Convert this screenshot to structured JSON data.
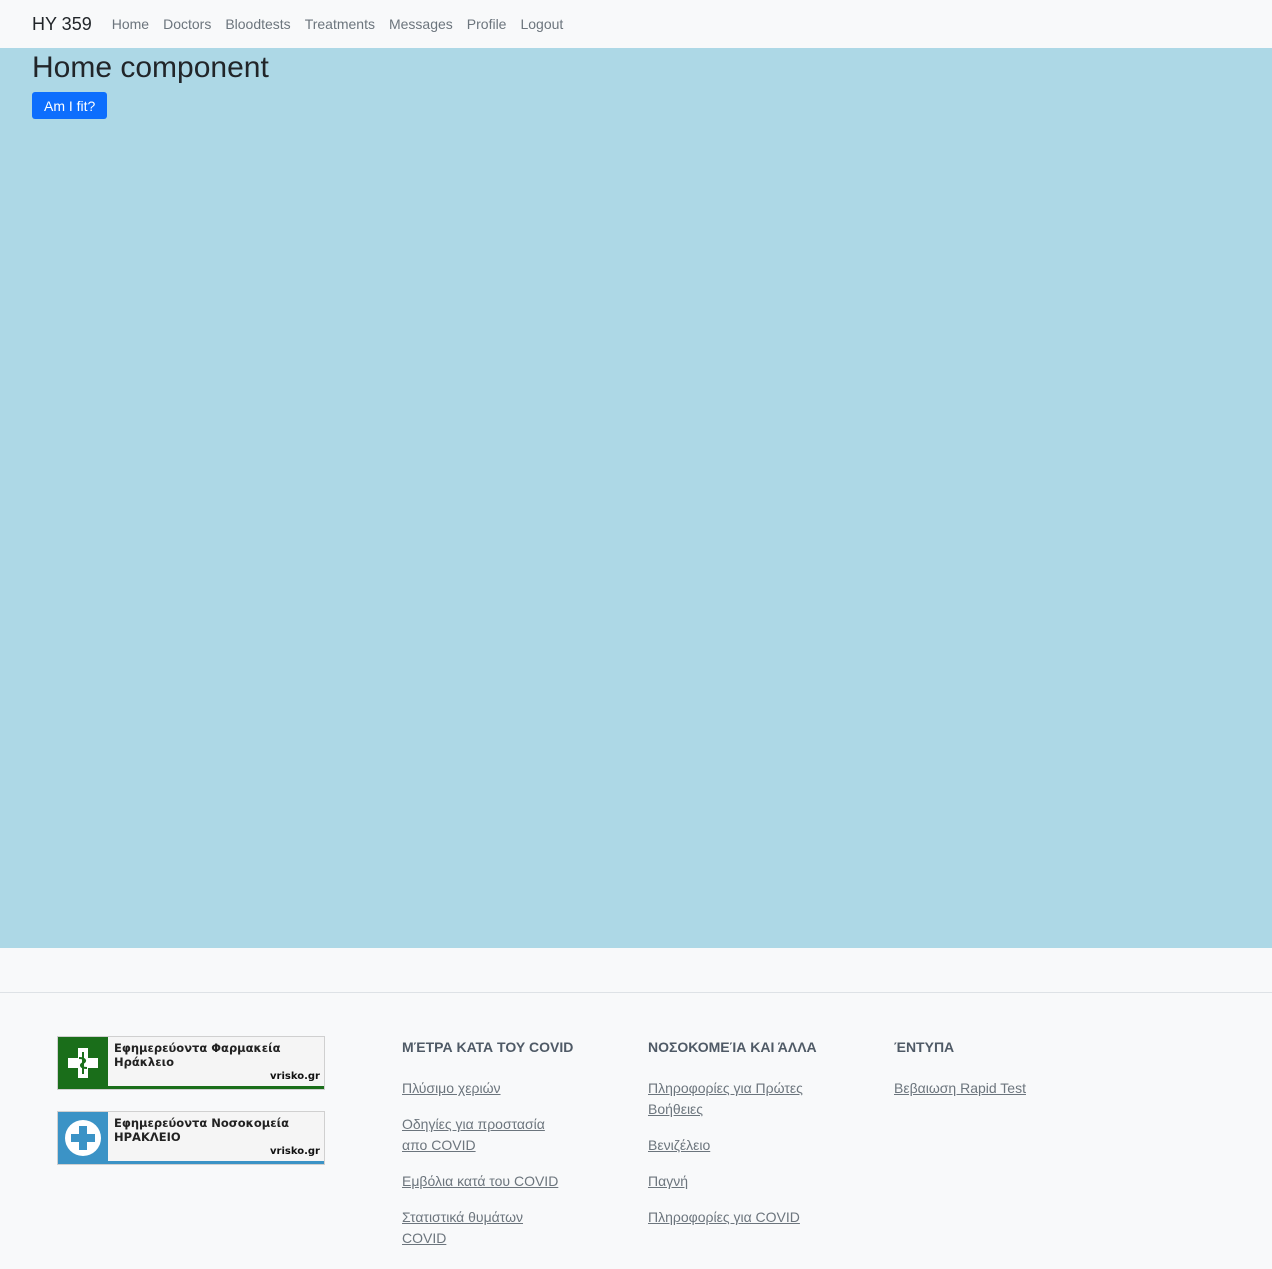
{
  "navbar": {
    "brand": "HY 359",
    "links": [
      "Home",
      "Doctors",
      "Bloodtests",
      "Treatments",
      "Messages",
      "Profile",
      "Logout"
    ]
  },
  "main": {
    "title": "Home component",
    "button_label": "Am I fit?",
    "background": "#add8e6"
  },
  "footer": {
    "widgets": [
      {
        "line1": "Εφημερεύοντα Φαρμακεία",
        "line2": "Ηράκλειο",
        "brand": "vrisko.gr",
        "icon": "pharmacy-cross-icon",
        "color": "#1a6e1a"
      },
      {
        "line1": "Εφημερεύοντα Νοσοκομεία",
        "line2": "ΗΡΑΚΛΕΙΟ",
        "brand": "vrisko.gr",
        "icon": "hospital-cross-icon",
        "color": "#3b93c6"
      }
    ],
    "columns": [
      {
        "heading": "ΜΈΤΡΑ ΚΑΤΑ ΤΟΥ COVID",
        "links": [
          "Πλύσιμο χεριών",
          "Οδηγίες για προστασία απο COVID",
          "Εμβόλια κατά του COVID",
          "Στατιστικά θυμάτων COVID"
        ]
      },
      {
        "heading": "ΝΟΣΟΚΟΜΕΊΑ ΚΑΙ ΆΛΛΑ",
        "links": [
          "Πληροφορίες για Πρώτες Βοήθειες",
          "Βενιζέλειο",
          "Παγνή",
          "Πληροφορίες για COVID"
        ]
      },
      {
        "heading": "ΈΝΤΥΠΑ",
        "links": [
          "Βεβαιωση Rapid Test"
        ]
      }
    ]
  }
}
